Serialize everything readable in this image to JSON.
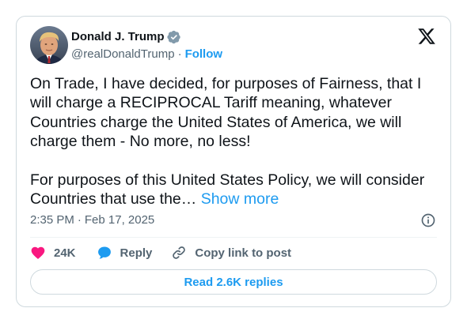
{
  "tweet": {
    "author": {
      "display_name": "Donald J. Trump",
      "handle": "@realDonaldTrump",
      "verified": true,
      "follow_label": "Follow",
      "separator": "·"
    },
    "text": "On Trade, I have decided, for purposes of Fairness, that I will charge a RECIPROCAL Tariff meaning, whatever Countries charge the United States of America, we will charge them - No more, no less!\n\nFor purposes of this United States Policy, we will consider Countries that use the… ",
    "show_more_label": "Show more",
    "time": "2:35 PM",
    "meta_separator": "·",
    "date": "Feb 17, 2025",
    "actions": {
      "likes": "24K",
      "reply_label": "Reply",
      "copy_label": "Copy link to post"
    },
    "read_replies_label": "Read 2.6K replies"
  },
  "icons": {
    "verified": "verified-badge-icon",
    "platform": "x-logo-icon",
    "info": "info-icon",
    "like": "heart-icon",
    "reply": "reply-bubble-icon",
    "copy": "link-icon"
  },
  "colors": {
    "accent": "#1d9bf0",
    "like": "#f91880",
    "muted_text": "#536471",
    "primary_text": "#0f1419",
    "border": "#cfd9de"
  }
}
